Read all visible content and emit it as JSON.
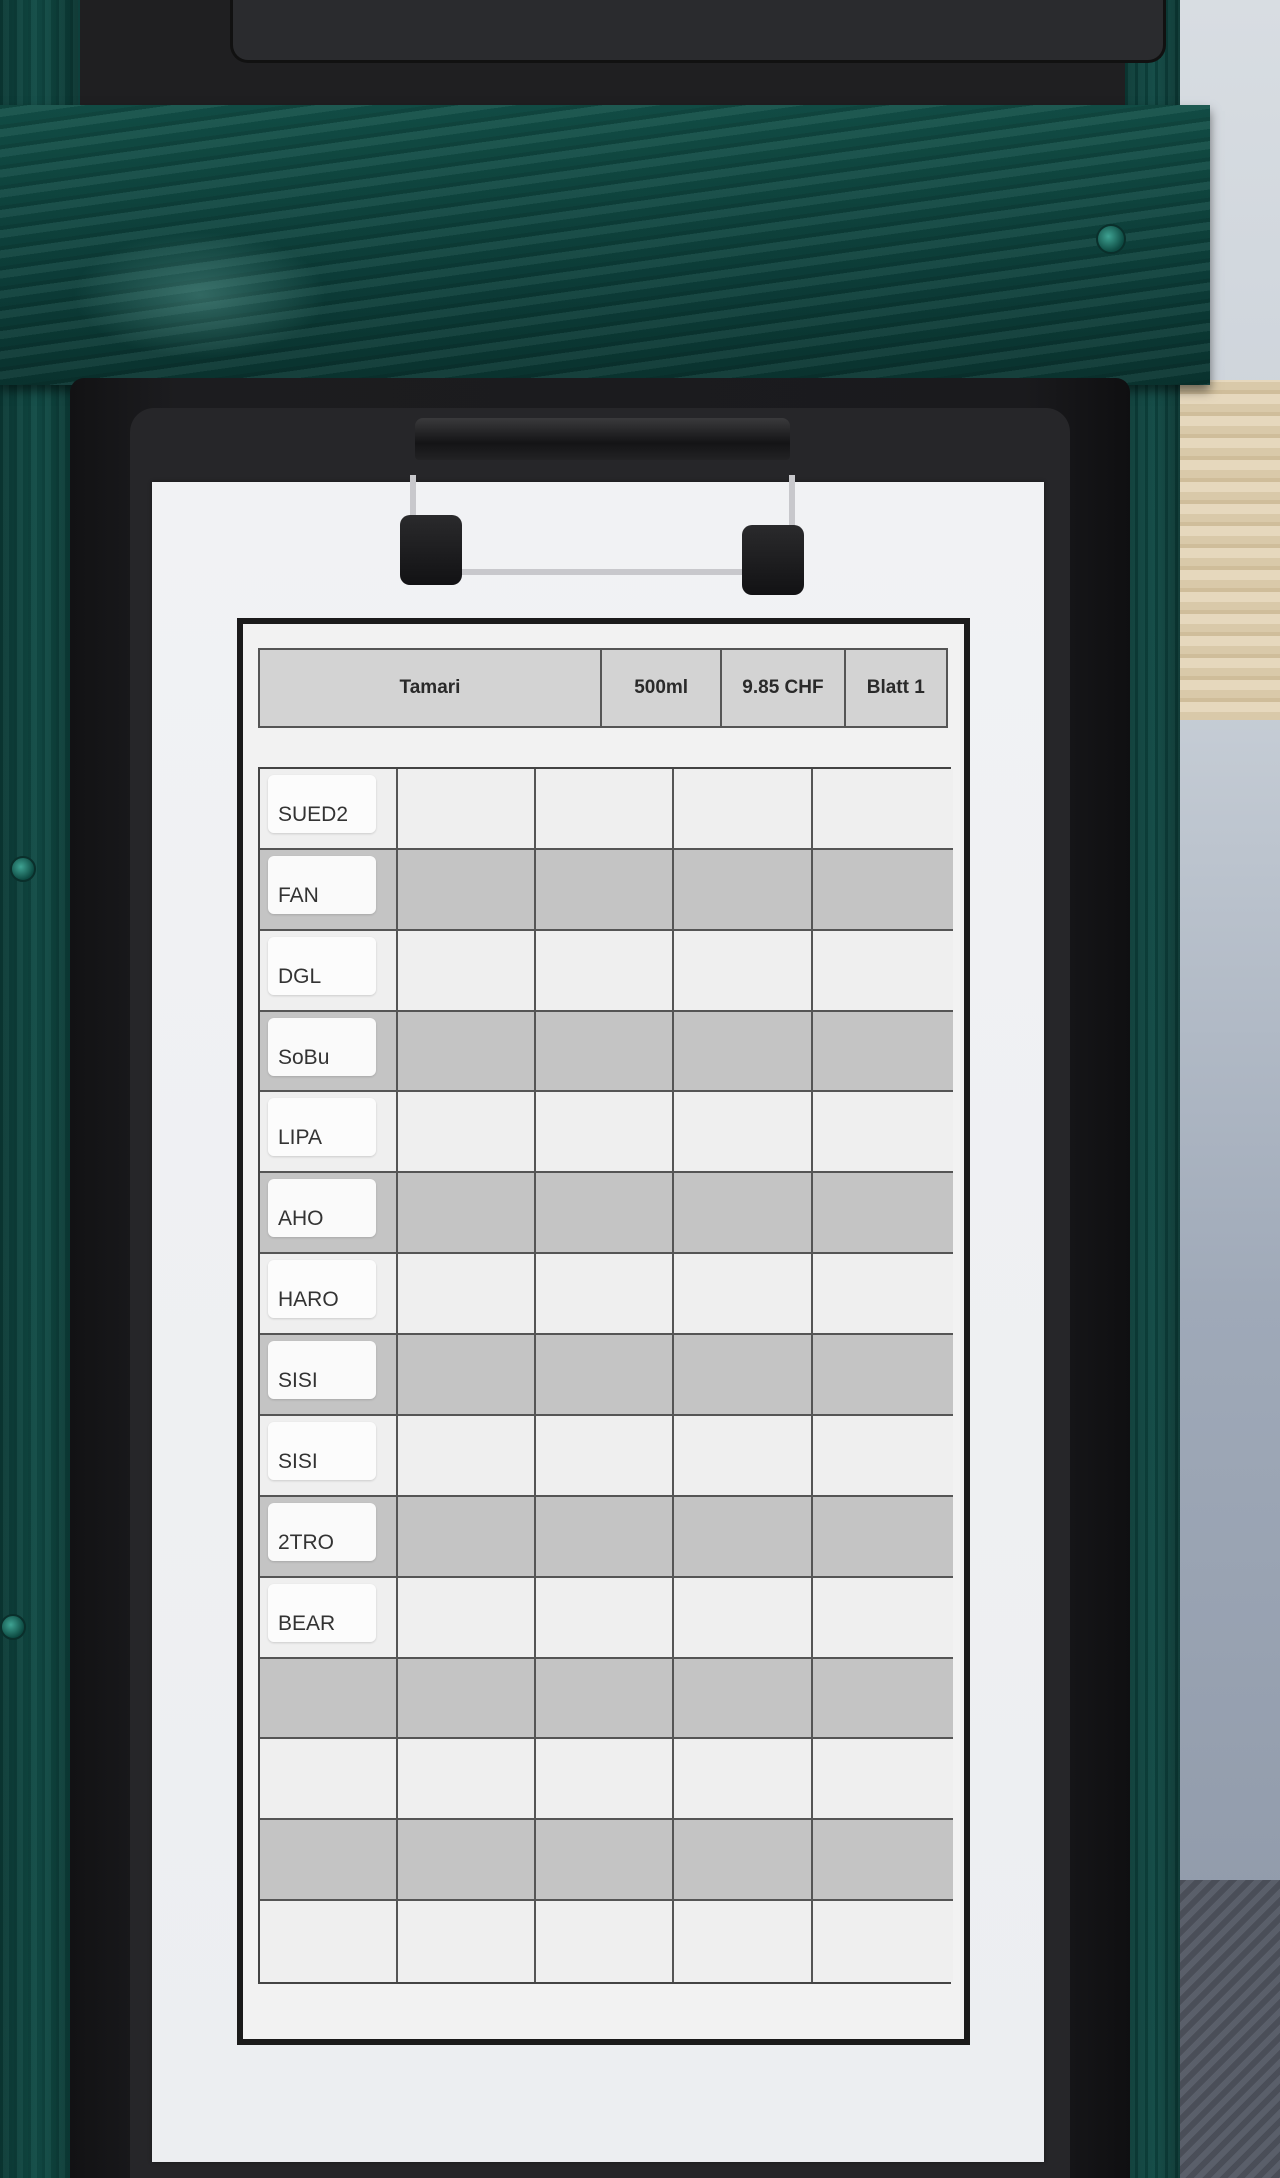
{
  "sheet": {
    "header": {
      "product": "Tamari",
      "volume": "500ml",
      "price": "9.85 CHF",
      "page": "Blatt 1"
    },
    "name_labels": [
      "SUED2",
      "FAN",
      "DGL",
      "SoBu",
      "LIPA",
      "AHO",
      "HARO",
      "SISI",
      "SISI",
      "2TRO",
      "BEAR"
    ],
    "rows": 15,
    "columns": 5
  },
  "colors": {
    "wood_green": "#0e3f3b",
    "clipboard_black": "#1c1c1f",
    "paper": "#f1f2f4",
    "row_light": "#efefef",
    "row_dark": "#c4c4c4"
  }
}
